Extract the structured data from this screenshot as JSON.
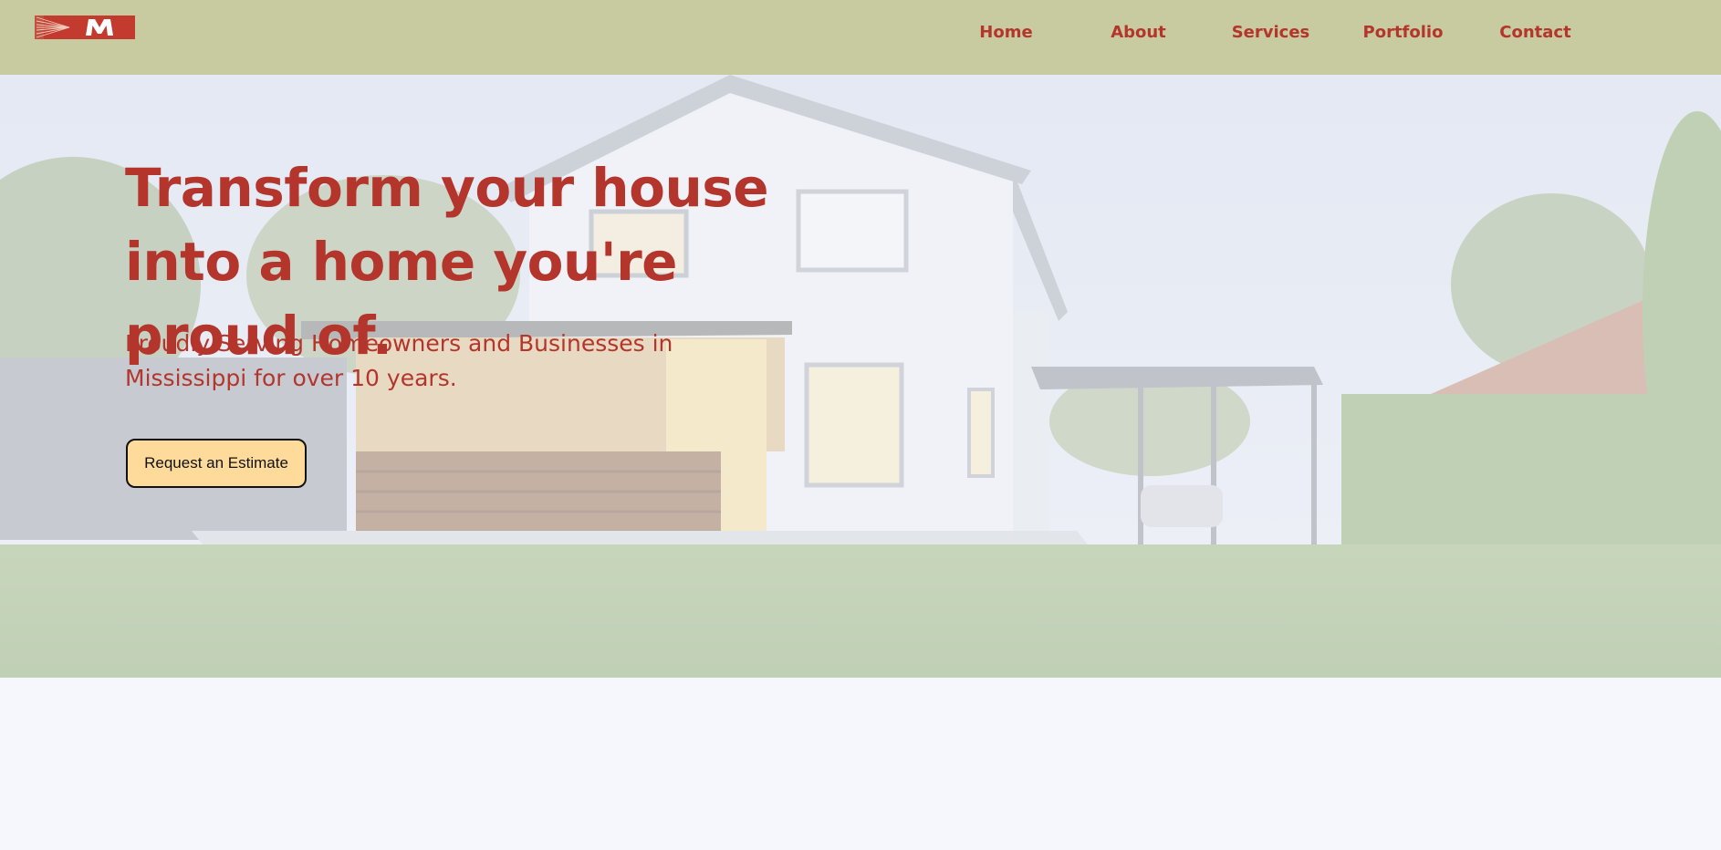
{
  "nav": {
    "logo_text": "M",
    "links": [
      {
        "label": "Home"
      },
      {
        "label": "About"
      },
      {
        "label": "Services"
      },
      {
        "label": "Portfolio"
      },
      {
        "label": "Contact"
      }
    ]
  },
  "hero": {
    "title": "Transform your house into a home you're proud of.",
    "subtitle": "Proudly Serving Homeowners and Businesses in Mississippi for over 10 years.",
    "cta_label": "Request an Estimate"
  },
  "colors": {
    "navbar": "#c8cb9f",
    "brand_red": "#b3352c",
    "cta_fill": "#fedb9b",
    "page_bg": "#f6f7fc"
  }
}
